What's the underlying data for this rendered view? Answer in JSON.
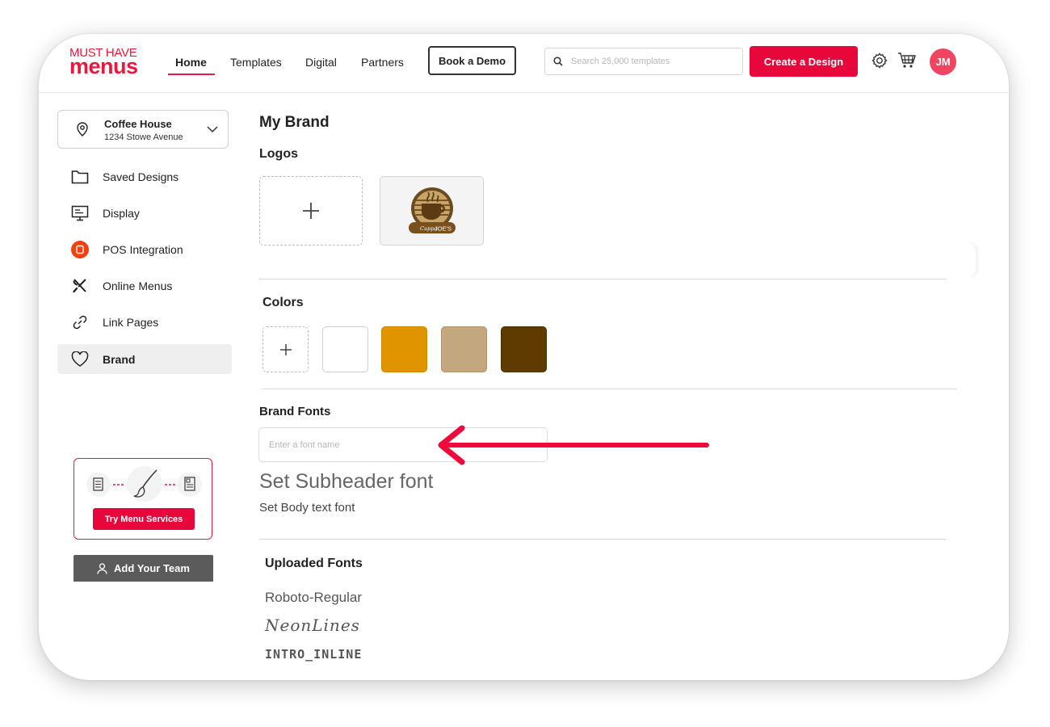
{
  "header": {
    "logo_line1": "MUST HAVE",
    "logo_line2": "menus",
    "nav": [
      "Home",
      "Templates",
      "Digital",
      "Partners"
    ],
    "book_demo": "Book a Demo",
    "search_placeholder": "Search 25,000 templates",
    "create_design": "Create a Design",
    "avatar_initials": "JM",
    "icons": [
      "search-icon",
      "gear-icon",
      "cart-icon"
    ]
  },
  "sidebar": {
    "location_name": "Coffee House",
    "location_address": "1234 Stowe Avenue",
    "items": [
      {
        "label": "Saved Designs",
        "icon": "folder-icon"
      },
      {
        "label": "Display",
        "icon": "monitor-icon"
      },
      {
        "label": "POS Integration",
        "icon": "pos-icon"
      },
      {
        "label": "Online Menus",
        "icon": "utensils-icon"
      },
      {
        "label": "Link Pages",
        "icon": "link-icon"
      },
      {
        "label": "Brand",
        "icon": "heart-icon"
      }
    ],
    "active_item": "Brand",
    "promo_button": "Try Menu Services",
    "team_button": "Add Your Team"
  },
  "main": {
    "title": "My Brand",
    "logos_heading": "Logos",
    "logo_text": "JOE'S",
    "logo_script": "Cuppa",
    "colors_heading": "Colors",
    "colors": [
      "#FFFFFF",
      "#E09500",
      "#C2A77F",
      "#5E3B00"
    ],
    "fonts_heading": "Brand Fonts",
    "font_placeholder": "Enter a font name",
    "subheader_font": "Set Subheader font",
    "body_font": "Set Body text font",
    "uploaded_heading": "Uploaded Fonts",
    "uploaded_fonts": [
      "Roboto-Regular",
      "NeonLines",
      "INTRO_INLINE"
    ]
  },
  "accent_color": "#E8073B"
}
